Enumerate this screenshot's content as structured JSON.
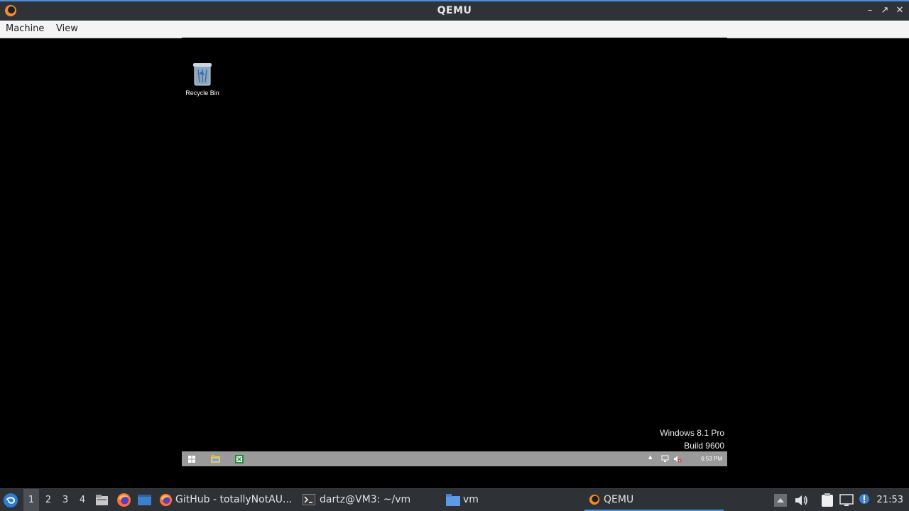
{
  "window": {
    "title": "QEMU",
    "controls": [
      "minimize",
      "maximize",
      "close"
    ]
  },
  "menubar": {
    "items": [
      "Machine",
      "View"
    ]
  },
  "guest": {
    "desktop_icons": [
      {
        "label": "Recycle Bin",
        "icon": "recycle-bin-icon"
      }
    ],
    "watermark": {
      "line1": "Windows 8.1 Pro",
      "line2": "Build 9600"
    },
    "taskbar": {
      "pinned": [
        "windows-start-icon",
        "file-explorer-icon",
        "excel-icon"
      ],
      "clock": "6:53 PM",
      "tray_icons": [
        "show-hidden-icons",
        "network-icon",
        "volume-muted-icon"
      ]
    }
  },
  "panel": {
    "workspaces": [
      "1",
      "2",
      "3",
      "4"
    ],
    "active_workspace": "1",
    "launchers": [
      "file-manager-icon",
      "firefox-icon",
      "desktop-icon"
    ],
    "tasks": [
      {
        "label": "GitHub - totallyNotAU...",
        "icon": "firefox-icon"
      },
      {
        "label": "dartz@VM3: ~/vm",
        "icon": "terminal-icon"
      },
      {
        "label": "vm",
        "icon": "folder-icon"
      },
      {
        "label": "QEMU",
        "icon": "qemu-icon",
        "active": true
      }
    ],
    "tray_icons": [
      "tray-arrow-icon",
      "volume-icon",
      "clipboard-icon",
      "screen-icon",
      "notification-icon"
    ],
    "clock": "21:53"
  },
  "colors": {
    "accent": "#4a90d9",
    "panel": "#2e3236",
    "guest_taskbar": "#9a9a9a"
  }
}
